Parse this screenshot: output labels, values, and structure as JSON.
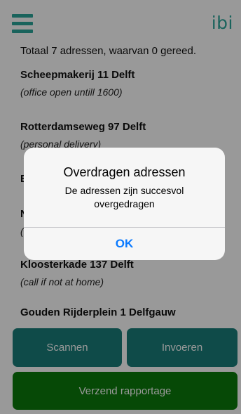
{
  "colors": {
    "teal": "#2aa59a",
    "button_teal": "#1a7e7a",
    "green": "#0b7a0b",
    "ios_blue": "#0a7aff"
  },
  "header": {
    "menu_icon": "hamburger-menu-icon",
    "logo_text": "ibi"
  },
  "summary": "Totaal 7 adressen, waarvan 0 gereed.",
  "addresses": [
    {
      "address": "Scheepmakerij 11 Delft",
      "note": "(office open untill 1600)"
    },
    {
      "address": "Rotterdamseweg 97 Delft",
      "note": "(personal delivery)"
    },
    {
      "address": "B",
      "note": ""
    },
    {
      "address": "N",
      "note": "("
    },
    {
      "address": "Kloosterkade 137 Delft",
      "note": "(call if not at home)"
    },
    {
      "address": "Gouden Rijderplein 1 Delfgauw",
      "note": ""
    }
  ],
  "buttons": {
    "scan": "Scannen",
    "input": "Invoeren",
    "send": "Verzend rapportage"
  },
  "dialog": {
    "title": "Overdragen adressen",
    "message": "De adressen zijn succesvol overgedragen",
    "ok": "OK"
  }
}
